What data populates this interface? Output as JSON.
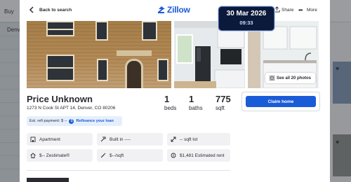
{
  "background_page": {
    "nav_label": "Buy",
    "search_label": "Denv"
  },
  "modal": {
    "back_label": "Back to search",
    "logo_text": "Zillow",
    "share_label": "Share",
    "more_label": "More",
    "see_all_label": "See all 20 photos",
    "price": "Price Unknown",
    "address": "1273 N Cook St APT 14, Denver, CO 80206",
    "stats": [
      {
        "value": "1",
        "label": "beds"
      },
      {
        "value": "1",
        "label": "baths"
      },
      {
        "value": "775",
        "label": "sqft"
      }
    ],
    "claim_label": "Claim home",
    "refi": {
      "text": "Est. refi payment: $ --",
      "link": "Refinance your loan"
    },
    "facts": [
      {
        "icon": "building-icon",
        "text": "Apartment"
      },
      {
        "icon": "hammer-icon",
        "text": "Built in ----"
      },
      {
        "icon": "expand-arrows-icon",
        "text": "-- sqft lot"
      },
      {
        "icon": "zestimate-house-icon",
        "text": "$-- Zestimate®"
      },
      {
        "icon": "ruler-icon",
        "text": "$--/sqft"
      },
      {
        "icon": "coins-icon",
        "text": "$1,481 Estimated rent"
      }
    ]
  },
  "clock": {
    "date": "30 Mar 2026",
    "time": "09:33"
  },
  "colors": {
    "brand_blue": "#1a5bd7",
    "text_dark": "#2a2a33",
    "fact_bg": "#f1f1f4",
    "clock_bg": "#0b1a3a"
  }
}
